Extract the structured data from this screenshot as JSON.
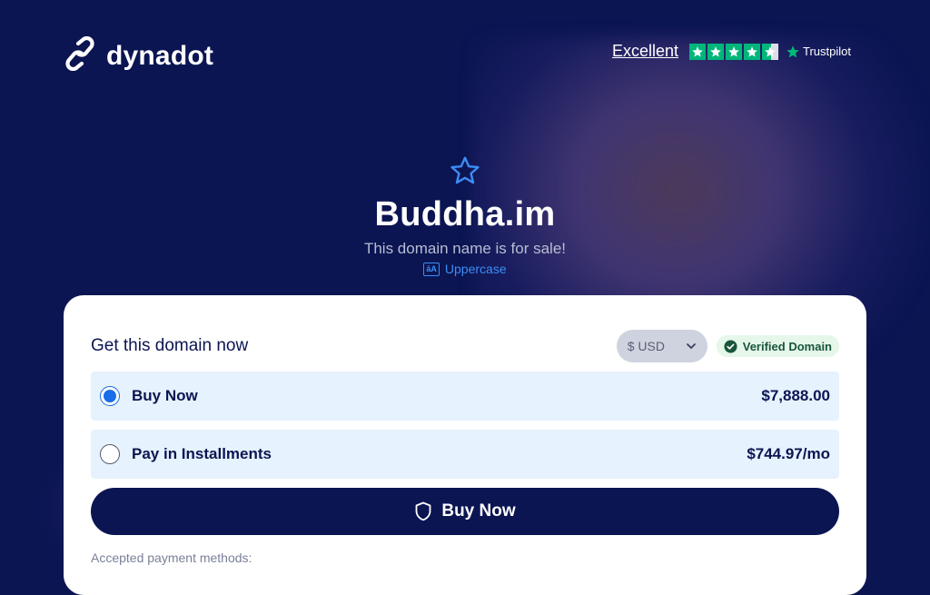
{
  "brand": {
    "name": "dynadot"
  },
  "trustpilot": {
    "rating_text": "Excellent",
    "brand": "Trustpilot",
    "score_fraction": 0.9,
    "star_color": "#00b67a"
  },
  "hero": {
    "domain": "Buddha.im",
    "subtitle": "This domain name is for sale!",
    "uppercase_label": "Uppercase",
    "uppercase_icon_text": "āA"
  },
  "card": {
    "title": "Get this domain now",
    "currency": "$ USD",
    "verified": "Verified Domain",
    "options": [
      {
        "label": "Buy Now",
        "price": "$7,888.00",
        "selected": true
      },
      {
        "label": "Pay in Installments",
        "price": "$744.97/mo",
        "selected": false
      }
    ],
    "buy_button": "Buy Now",
    "payment_label": "Accepted payment methods:"
  },
  "colors": {
    "background": "#0b1552",
    "accent": "#1a6de8",
    "link": "#3d8df5",
    "option_bg": "#e6f2fd"
  }
}
